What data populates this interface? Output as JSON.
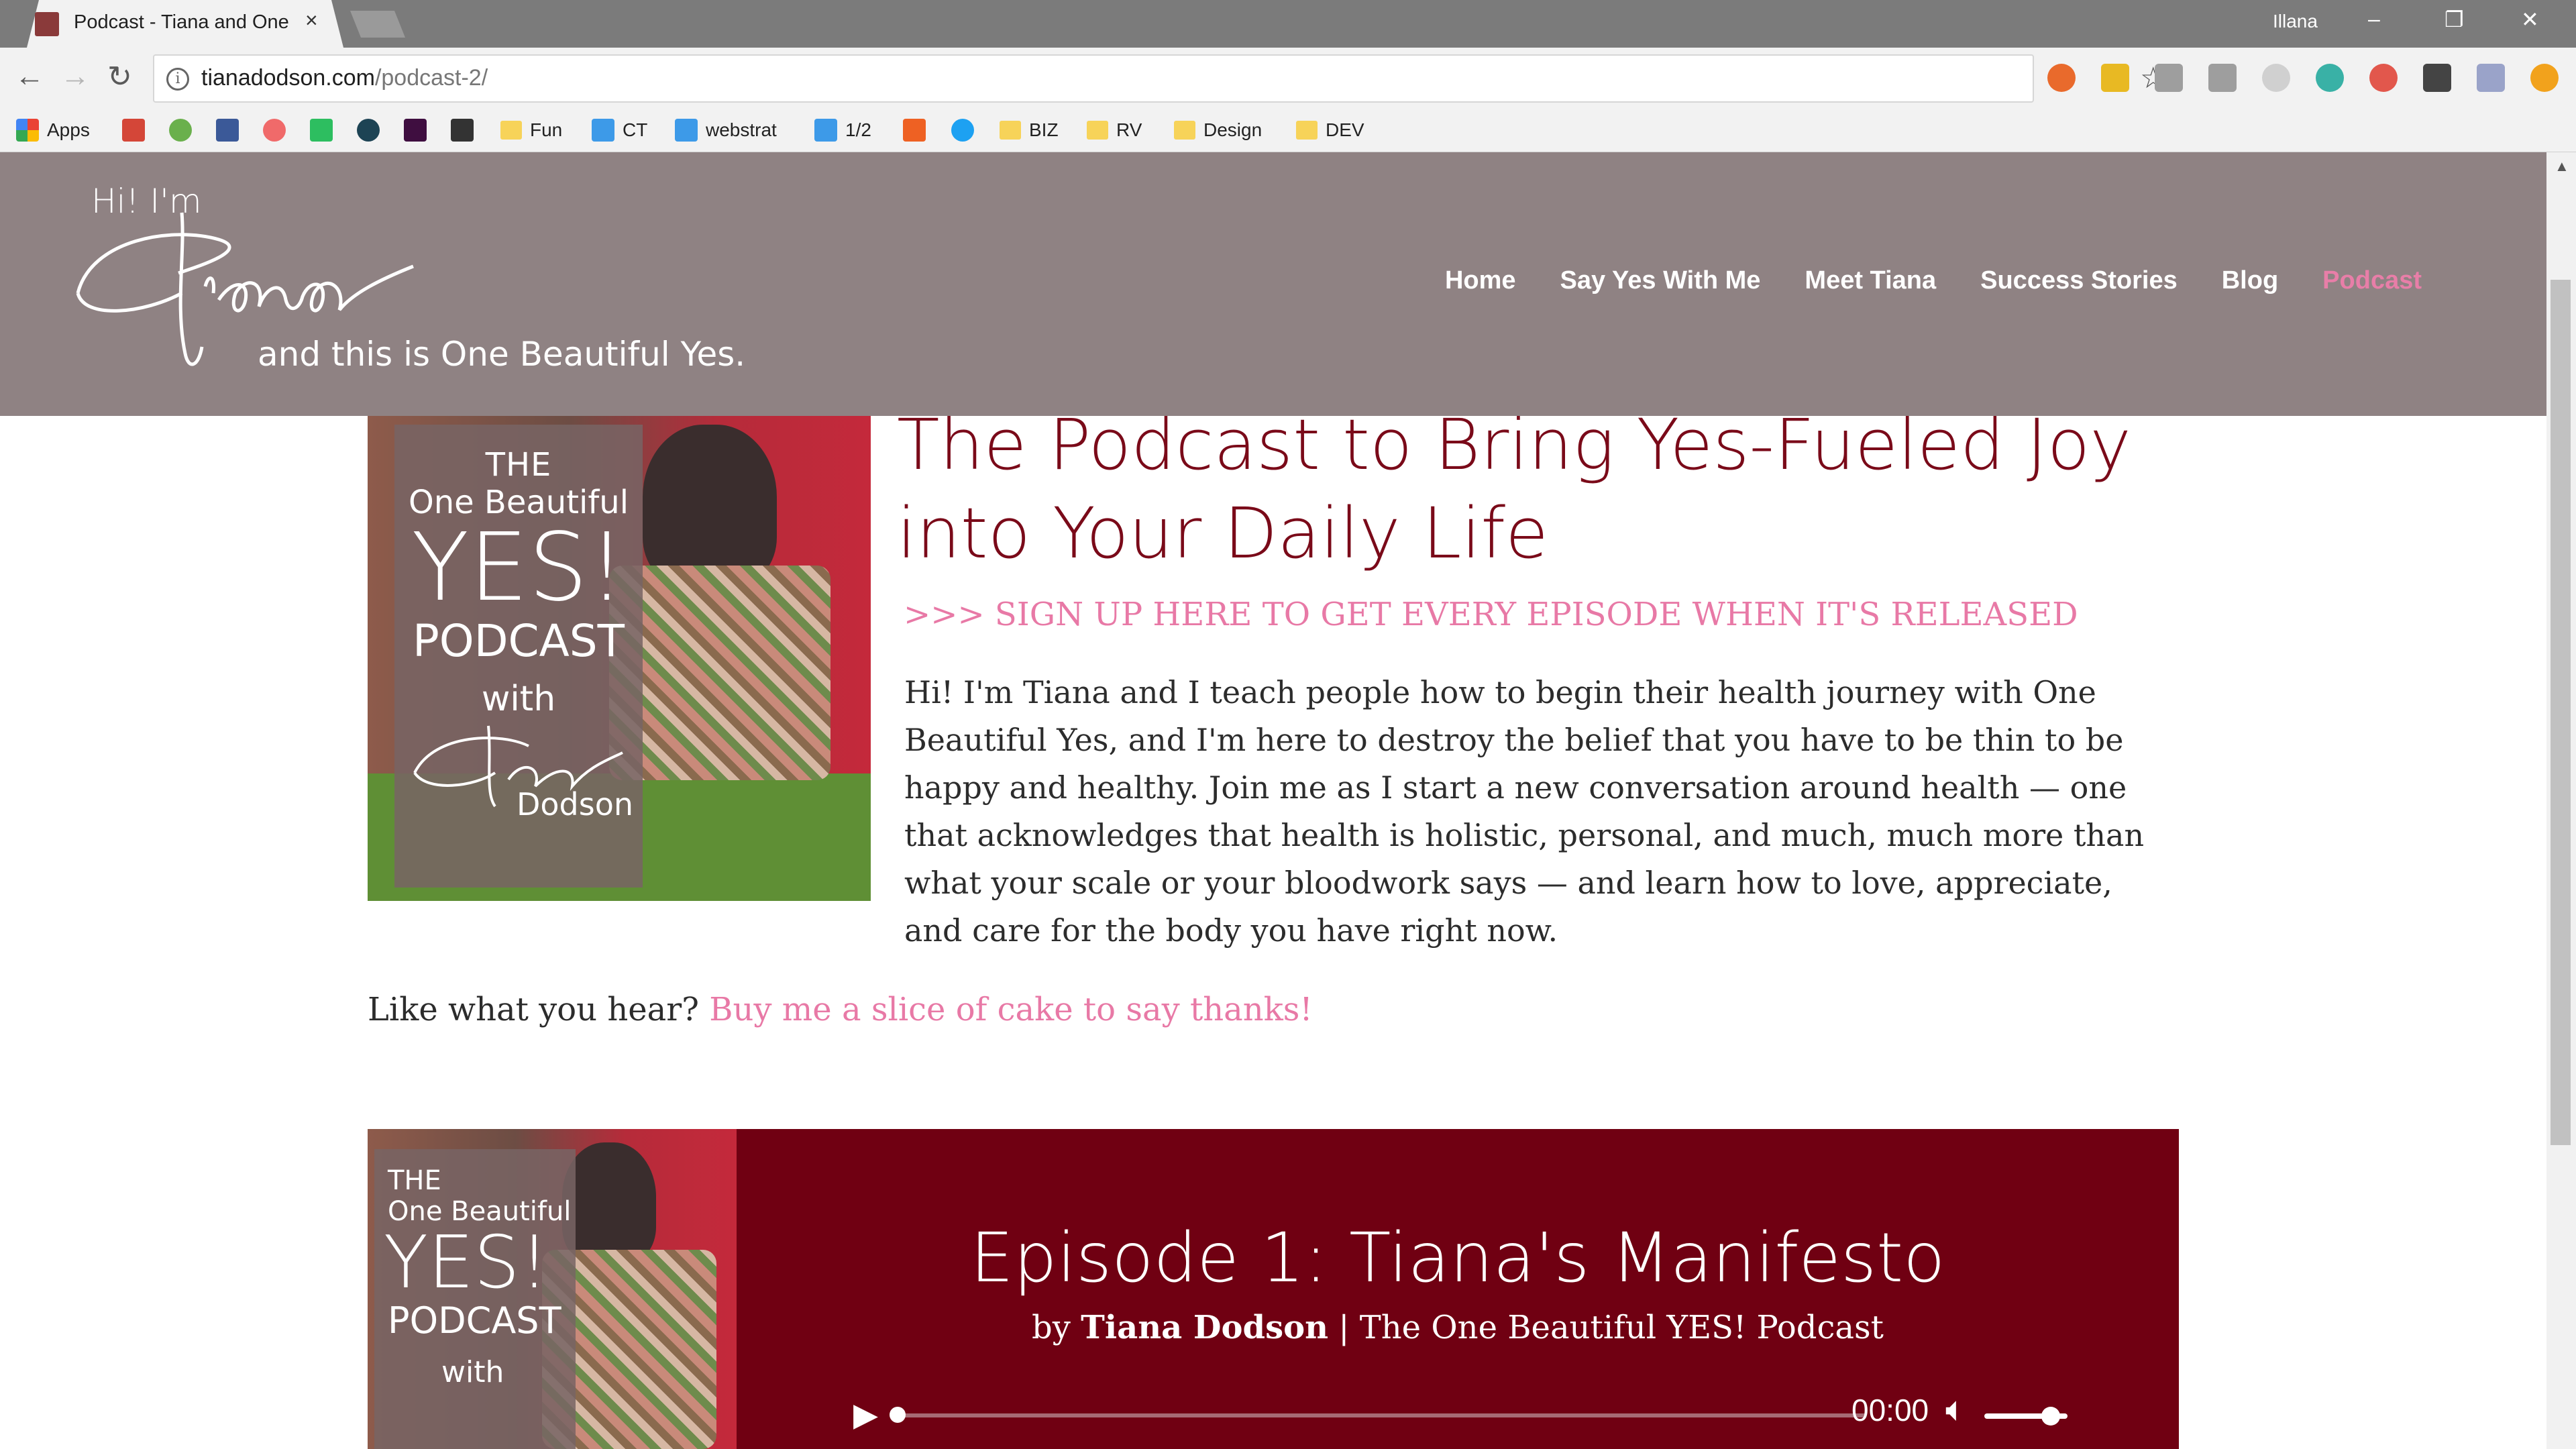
{
  "browser": {
    "tab_title": "Podcast - Tiana and One",
    "tab_close": "×",
    "profile_name": "Illana",
    "window_controls": {
      "minimize": "–",
      "restore": "❐",
      "close": "✕"
    },
    "nav": {
      "back": "←",
      "forward": "→",
      "reload": "↻"
    },
    "url_host": "tianadodson.com",
    "url_path": "/podcast-2/",
    "info_icon": "i",
    "star_icon": "☆",
    "bookmarks": [
      "Apps",
      "Fun",
      "CT",
      "webstrat",
      "1/2",
      "BIZ",
      "RV",
      "Design",
      "DEV"
    ],
    "extension_icon_colors": [
      "#e96a2c",
      "#e8b923",
      "#9e9e9e",
      "#9e9e9e",
      "#b0b0b0",
      "#39b1a6",
      "#e2574c",
      "#444444",
      "#9aa3c9",
      "#f2a21c"
    ]
  },
  "site": {
    "logo_hi": "Hi! I'm",
    "logo_tagline": "and this is One Beautiful Yes.",
    "nav": [
      "Home",
      "Say Yes With Me",
      "Meet Tiana",
      "Success Stories",
      "Blog",
      "Podcast"
    ],
    "nav_active_color": "#e87ea8"
  },
  "cover": {
    "line1": "THE",
    "line2": "One Beautiful",
    "line3": "YES!",
    "line4": "PODCAST",
    "line5": "with",
    "line6": "Dodson"
  },
  "content": {
    "heading": "The Podcast to Bring Yes-Fueled Joy into Your Daily Life",
    "signup": ">>> SIGN UP HERE TO GET EVERY EPISODE WHEN IT'S RELEASED",
    "intro": "Hi! I'm Tiana and I teach people how to begin their health journey with One Beautiful Yes, and I'm here to destroy the belief that you have to be thin to be happy and healthy. Join me as I start a new conversation around health — one that acknowledges that health is holistic, personal, and much, much more than what your scale or your bloodwork says — and learn how to love, appreciate, and care for the body you have right now.",
    "like_prefix": "Like what you hear?",
    "cake_link": "Buy me a slice of cake to say thanks!",
    "heading_color": "#7a0a19",
    "link_color": "#e879a6"
  },
  "player": {
    "episode_title": "Episode 1: Tiana's Manifesto",
    "by_prefix": "by",
    "author": "Tiana Dodson",
    "separator": " | ",
    "show": "The One Beautiful YES! Podcast",
    "time": "00:00",
    "progress": 0,
    "volume": 0.8,
    "background_color": "#700012"
  }
}
